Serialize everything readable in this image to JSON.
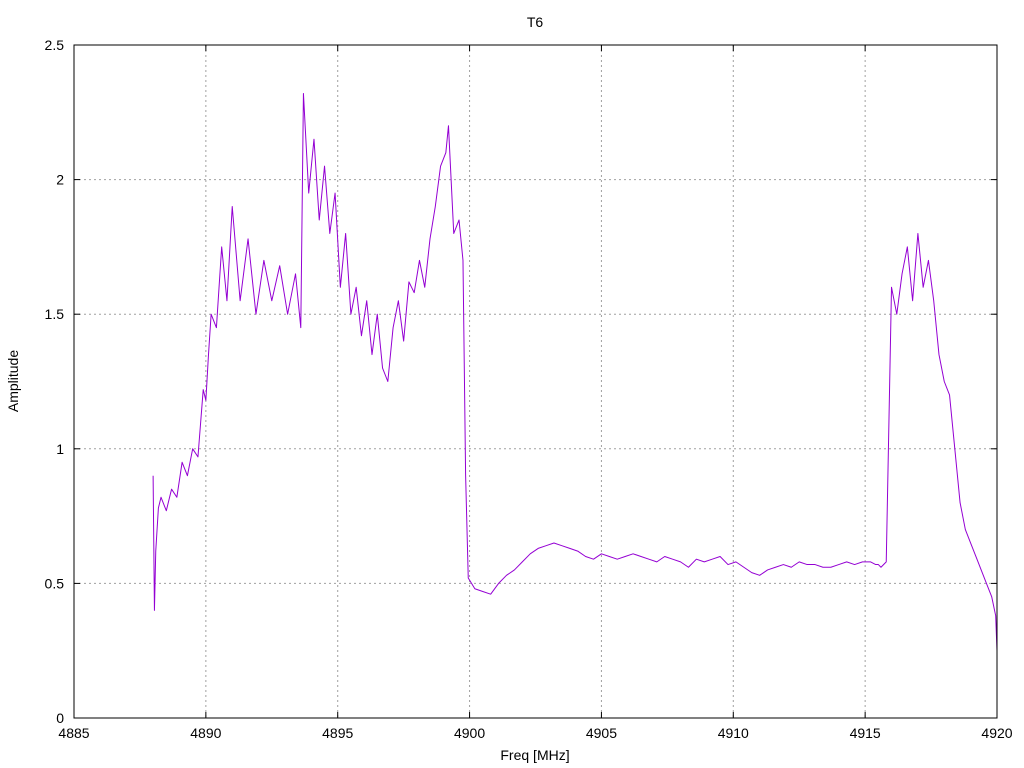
{
  "chart_data": {
    "type": "line",
    "title": "T6",
    "xlabel": "Freq [MHz]",
    "ylabel": "Amplitude",
    "xlim": [
      4885,
      4920
    ],
    "ylim": [
      0,
      2.5
    ],
    "xticks": [
      4885,
      4890,
      4895,
      4900,
      4905,
      4910,
      4915,
      4920
    ],
    "yticks": [
      0,
      0.5,
      1,
      1.5,
      2,
      2.5
    ],
    "xtick_labels": [
      "4885",
      "4890",
      "4895",
      "4900",
      "4905",
      "4910",
      "4915",
      "4920"
    ],
    "ytick_labels": [
      "0",
      "0.5",
      "1",
      "1.5",
      "2",
      "2.5"
    ],
    "grid": true,
    "colors": {
      "series": "#9400d3",
      "grid": "#a0a0a0",
      "frame": "#000000"
    },
    "series": [
      {
        "x": [
          4888.0,
          4888.05,
          4888.1,
          4888.2,
          4888.3,
          4888.5,
          4888.7,
          4888.9,
          4889.1,
          4889.3,
          4889.5,
          4889.7,
          4889.9,
          4890.0,
          4890.1,
          4890.2,
          4890.4,
          4890.6,
          4890.8,
          4891.0,
          4891.3,
          4891.6,
          4891.9,
          4892.2,
          4892.5,
          4892.8,
          4893.1,
          4893.4,
          4893.6,
          4893.7,
          4893.9,
          4894.1,
          4894.3,
          4894.5,
          4894.7,
          4894.9,
          4895.1,
          4895.3,
          4895.5,
          4895.7,
          4895.9,
          4896.1,
          4896.3,
          4896.5,
          4896.7,
          4896.9,
          4897.1,
          4897.3,
          4897.5,
          4897.7,
          4897.9,
          4898.1,
          4898.3,
          4898.5,
          4898.7,
          4898.9,
          4899.1,
          4899.2,
          4899.4,
          4899.6,
          4899.75,
          4899.85,
          4899.95,
          4900.2,
          4900.5,
          4900.8,
          4901.1,
          4901.4,
          4901.7,
          4902.0,
          4902.3,
          4902.6,
          4902.9,
          4903.2,
          4903.5,
          4903.8,
          4904.1,
          4904.4,
          4904.7,
          4905.0,
          4905.3,
          4905.6,
          4905.9,
          4906.2,
          4906.5,
          4906.8,
          4907.1,
          4907.4,
          4907.7,
          4908.0,
          4908.3,
          4908.6,
          4908.9,
          4909.2,
          4909.5,
          4909.8,
          4910.1,
          4910.4,
          4910.7,
          4911.0,
          4911.3,
          4911.6,
          4911.9,
          4912.2,
          4912.5,
          4912.8,
          4913.1,
          4913.4,
          4913.7,
          4914.0,
          4914.3,
          4914.6,
          4914.9,
          4915.2,
          4915.4,
          4915.5,
          4915.6,
          4915.8,
          4916.0,
          4916.2,
          4916.4,
          4916.6,
          4916.8,
          4917.0,
          4917.2,
          4917.4,
          4917.6,
          4917.8,
          4918.0,
          4918.2,
          4918.4,
          4918.6,
          4918.8,
          4919.0,
          4919.2,
          4919.4,
          4919.6,
          4919.8,
          4919.95,
          4920.0
        ],
        "y": [
          0.9,
          0.4,
          0.62,
          0.78,
          0.82,
          0.77,
          0.85,
          0.82,
          0.95,
          0.9,
          1.0,
          0.97,
          1.22,
          1.18,
          1.35,
          1.5,
          1.45,
          1.75,
          1.55,
          1.9,
          1.55,
          1.78,
          1.5,
          1.7,
          1.55,
          1.68,
          1.5,
          1.65,
          1.45,
          2.32,
          1.95,
          2.15,
          1.85,
          2.05,
          1.8,
          1.95,
          1.6,
          1.8,
          1.5,
          1.6,
          1.42,
          1.55,
          1.35,
          1.5,
          1.3,
          1.25,
          1.45,
          1.55,
          1.4,
          1.62,
          1.58,
          1.7,
          1.6,
          1.78,
          1.9,
          2.05,
          2.1,
          2.2,
          1.8,
          1.85,
          1.7,
          0.9,
          0.52,
          0.48,
          0.47,
          0.46,
          0.5,
          0.53,
          0.55,
          0.58,
          0.61,
          0.63,
          0.64,
          0.65,
          0.64,
          0.63,
          0.62,
          0.6,
          0.59,
          0.61,
          0.6,
          0.59,
          0.6,
          0.61,
          0.6,
          0.59,
          0.58,
          0.6,
          0.59,
          0.58,
          0.56,
          0.59,
          0.58,
          0.59,
          0.6,
          0.57,
          0.58,
          0.56,
          0.54,
          0.53,
          0.55,
          0.56,
          0.57,
          0.56,
          0.58,
          0.57,
          0.57,
          0.56,
          0.56,
          0.57,
          0.58,
          0.57,
          0.58,
          0.58,
          0.57,
          0.57,
          0.56,
          0.58,
          1.6,
          1.5,
          1.65,
          1.75,
          1.55,
          1.8,
          1.6,
          1.7,
          1.55,
          1.35,
          1.25,
          1.2,
          1.0,
          0.8,
          0.7,
          0.65,
          0.6,
          0.55,
          0.5,
          0.45,
          0.38,
          0.25
        ]
      }
    ]
  }
}
